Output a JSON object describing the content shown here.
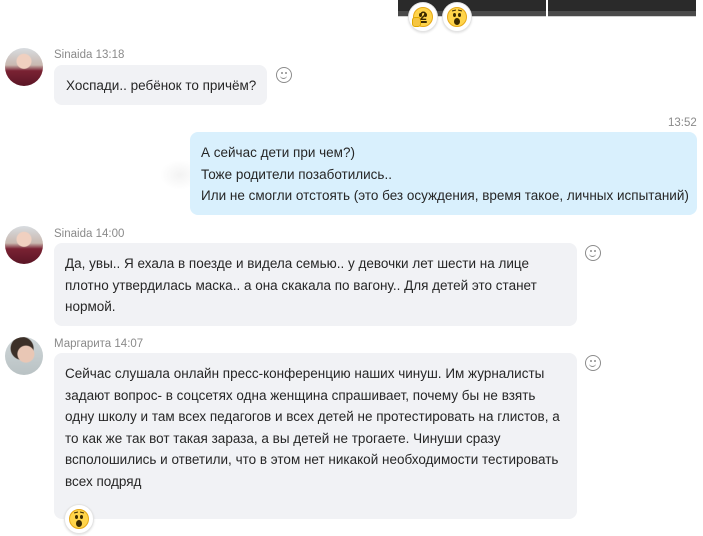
{
  "top": {
    "reactions": [
      {
        "icon": "face-with-hand-over-mouth-emoji",
        "count": "2"
      },
      {
        "icon": "face-screaming-emoji"
      }
    ]
  },
  "messages": [
    {
      "id": "m1",
      "sender": "Sinaida",
      "time": "13:18",
      "direction": "incoming",
      "lines": [
        "Хоспади.. ребёнок то причём?"
      ]
    },
    {
      "id": "m2",
      "time": "13:52",
      "direction": "outgoing",
      "lines": [
        "А сейчас дети при чем?)",
        "Тоже родители позаботились..",
        "Или не смогли отстоять (это без осуждения, время такое, личных испытаний)"
      ]
    },
    {
      "id": "m3",
      "sender": "Sinaida",
      "time": "14:00",
      "direction": "incoming",
      "lines": [
        "Да, увы.. Я ехала в поезде и видела семью.. у девочки лет шести на лице",
        "плотно утвердилась маска.. а она скакала по вагону.. Для детей это станет",
        "нормой."
      ]
    },
    {
      "id": "m4",
      "sender": "Маргарита",
      "time": "14:07",
      "direction": "incoming",
      "lines": [
        "Сейчас слушала онлайн пресс-конференцию наших чинуш. Им журналисты",
        "задают вопрос- в соцсетях одна женщина спрашивает, почему бы не взять",
        "одну школу и там всех педагогов и всех детей не протестировать на глистов, а",
        "то как же так вот такая зараза, а вы детей не трогаете. Чинуши сразу",
        "всполошились и ответили, что в этом нет никакой необходимости тестировать",
        "всех подряд"
      ],
      "reaction": {
        "icon": "face-screaming-emoji"
      }
    }
  ],
  "colors": {
    "incoming_bubble": "#f1f2f5",
    "outgoing_bubble": "#d9f0fd",
    "meta_text": "#8a8a8a"
  }
}
